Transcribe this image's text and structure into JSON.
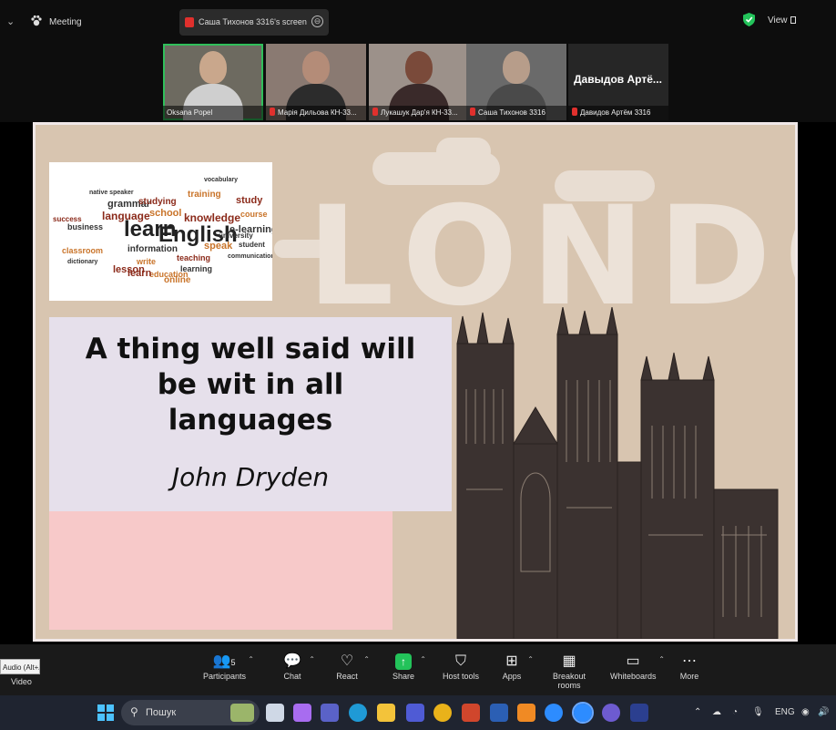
{
  "topbar": {
    "meeting_label": "Meeting",
    "share_label": "Саша Тихонов 3316's screen",
    "view_label": "View"
  },
  "participants_strip": [
    {
      "name": "Oksana Popel",
      "muted": false,
      "active": true
    },
    {
      "name": "Марія Дильова КН-33...",
      "muted": true
    },
    {
      "name": "Лукашук Дар'я КН-33...",
      "muted": true
    },
    {
      "name": "Саша Тихонов 3316",
      "muted": true
    },
    {
      "name": "Давидов Артём 3316",
      "muted": true,
      "display_name": "Давыдов Артё..."
    }
  ],
  "slide": {
    "background_word": "LONDON",
    "quote": "A thing well said will be wit in all languages",
    "author": "John Dryden",
    "word_cloud_words": [
      "learn",
      "English",
      "language",
      "school",
      "knowledge",
      "grammar",
      "studying",
      "training",
      "study",
      "e-learning",
      "course",
      "speak",
      "information",
      "teaching",
      "learning",
      "lesson",
      "education",
      "classroom",
      "online",
      "business",
      "native speaker",
      "university",
      "student",
      "write",
      "dictionary",
      "success",
      "communication",
      "vocabulary",
      "learn"
    ]
  },
  "toolbar": {
    "tooltip": "Audio (Alt+A)",
    "video_label": "Video",
    "participants_label": "Participants",
    "participants_count": "5",
    "chat_label": "Chat",
    "react_label": "React",
    "share_label": "Share",
    "host_tools_label": "Host tools",
    "apps_label": "Apps",
    "breakout_label": "Breakout rooms",
    "whiteboards_label": "Whiteboards",
    "more_label": "More"
  },
  "taskbar": {
    "search_placeholder": "Пошук",
    "language": "ENG"
  },
  "colors": {
    "accent_green": "#2fbf5a",
    "share_green": "#23c35a",
    "slide_bg": "#d8c5b0",
    "quote_box": "#e6e0eb",
    "pink_box": "#f7c9c9"
  }
}
